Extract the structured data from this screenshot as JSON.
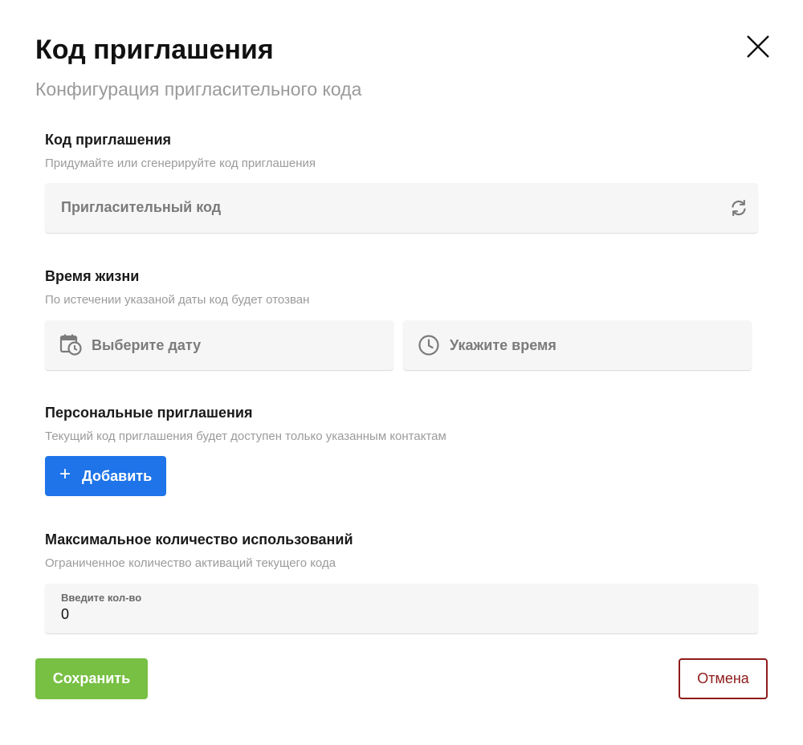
{
  "dialog": {
    "title": "Код приглашения",
    "subtitle": "Конфигурация пригласительного кода"
  },
  "invite_code": {
    "title": "Код приглашения",
    "description": "Придумайте или сгенерируйте код приглашения",
    "placeholder": "Пригласительный код",
    "generate_icon": "refresh-icon"
  },
  "lifetime": {
    "title": "Время жизни",
    "description": "По истечении указаной даты код будет отозван",
    "date_placeholder": "Выберите дату",
    "date_icon": "calendar-clock-icon",
    "time_placeholder": "Укажите время",
    "time_icon": "clock-icon"
  },
  "personal": {
    "title": "Персональные приглашения",
    "description": "Текущий код приглашения будет доступен только указанным контактам",
    "add_label": "Добавить",
    "add_icon": "plus-icon"
  },
  "max_uses": {
    "title": "Максимальное количество использований",
    "description": "Ограниченное количество активаций текущего кода",
    "field_label": "Введите кол-во",
    "value": "0"
  },
  "actions": {
    "save_label": "Сохранить",
    "cancel_label": "Отмена"
  },
  "colors": {
    "primary": "#1e74e8",
    "save": "#78c043",
    "cancel": "#8e1b1b",
    "field_bg": "#f6f6f6"
  }
}
